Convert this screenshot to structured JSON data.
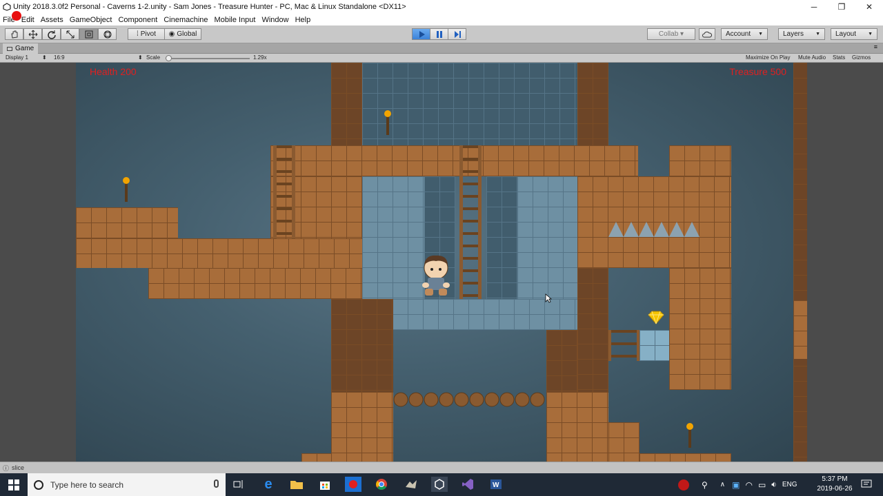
{
  "window": {
    "title": "Unity 2018.3.0f2 Personal - Caverns 1-2.unity - Sam Jones - Treasure Hunter - PC, Mac & Linux Standalone <DX11>",
    "minimize": "─",
    "maximize": "❐",
    "close": "✕"
  },
  "menu": [
    "File",
    "Edit",
    "Assets",
    "GameObject",
    "Component",
    "Cinemachine",
    "Mobile Input",
    "Window",
    "Help"
  ],
  "toolbar": {
    "pivot": "Pivot",
    "global": "Global",
    "collab": "Collab ▾",
    "account": "Account",
    "layers": "Layers",
    "layout": "Layout"
  },
  "game_panel": {
    "tab": "Game",
    "display": "Display 1",
    "aspect": "16:9",
    "scale_label": "Scale",
    "scale_value": "1.29x",
    "scale_fraction": 0.0,
    "maximize_on_play": "Maximize On Play",
    "mute_audio": "Mute Audio",
    "stats": "Stats",
    "gizmos": "Gizmos"
  },
  "hud": {
    "health": "Health 200",
    "treasure": "Treasure 500"
  },
  "status": {
    "message": "slice"
  },
  "taskbar": {
    "search_placeholder": "Type here to search",
    "language": "ENG",
    "time": "5:37 PM",
    "date": "2019-06-26"
  },
  "colors": {
    "hud_text": "#e02020",
    "play_active": "#3b82d8",
    "brick": "#a86d3a",
    "stone": "#6e90a3",
    "treasure_gem": "#f5c400"
  }
}
